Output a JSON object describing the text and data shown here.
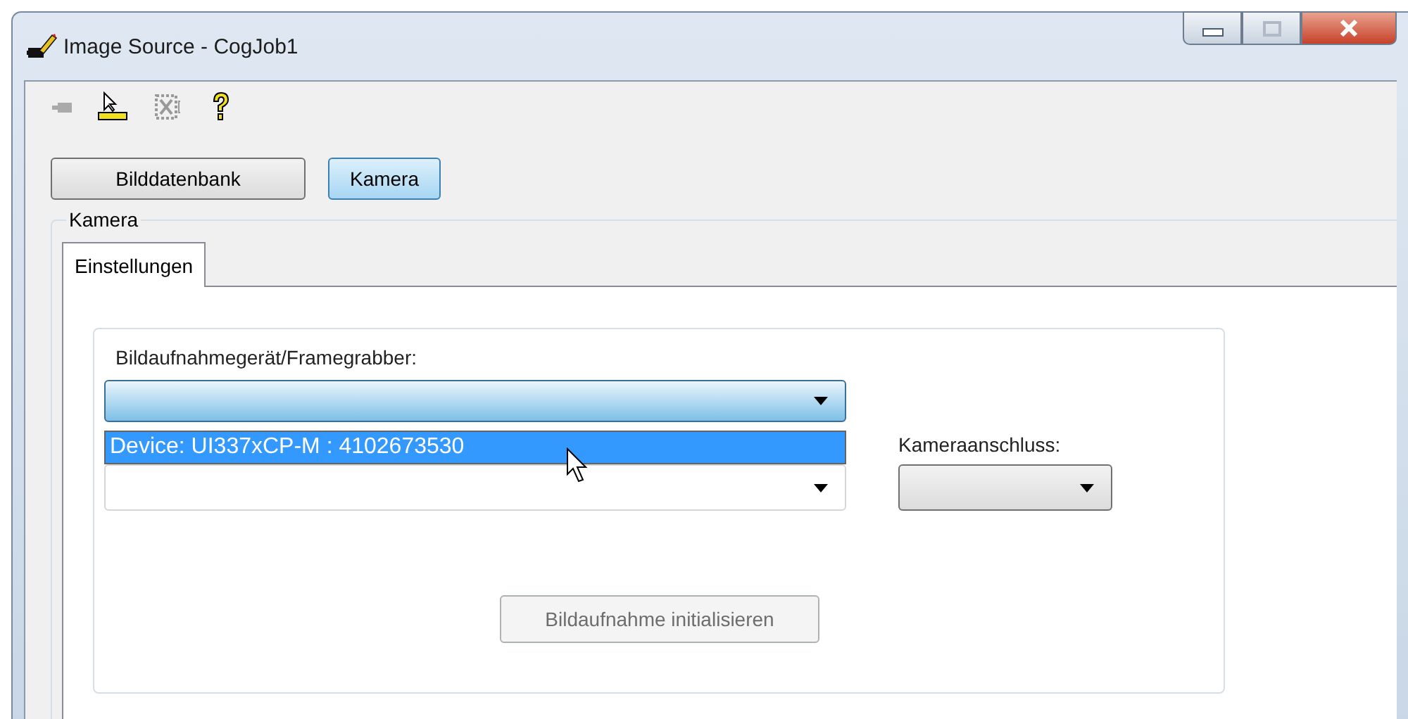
{
  "window": {
    "title": "Image Source - CogJob1"
  },
  "source_buttons": [
    {
      "label": "Bilddatenbank",
      "selected": false
    },
    {
      "label": "Kamera",
      "selected": true
    }
  ],
  "group": {
    "title": "Kamera"
  },
  "tabs": [
    {
      "label": "Einstellungen",
      "selected": true
    }
  ],
  "device": {
    "label": "Bildaufnahmegerät/Framegrabber:",
    "expanded": true,
    "options": [
      {
        "label": "Device: UI337xCP-M : 4102673530",
        "selected": true
      }
    ]
  },
  "camera_port": {
    "label": "Kameraanschluss:"
  },
  "init_button": {
    "label": "Bildaufnahme initialisieren",
    "disabled": true
  }
}
